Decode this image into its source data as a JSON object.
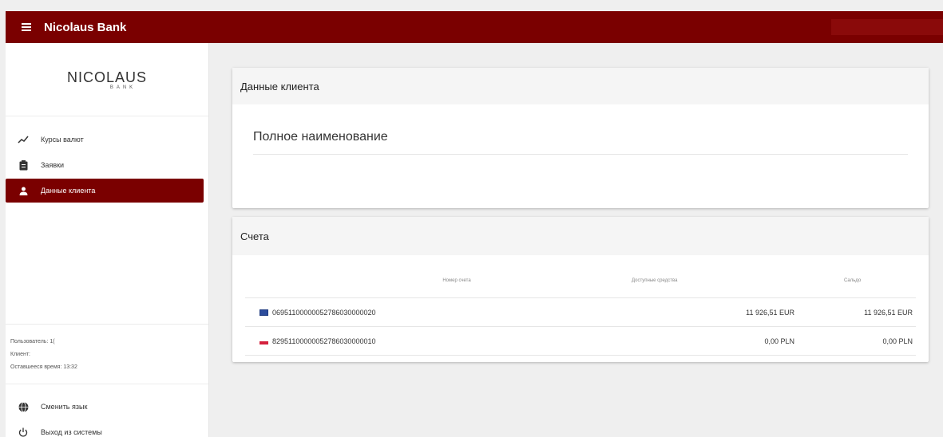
{
  "header": {
    "title": "Nicolaus Bank",
    "bg_color": "#7a0000"
  },
  "sidebar": {
    "logo_main": "NICOLAUS",
    "logo_sub": "BANK",
    "items": [
      {
        "label": "Курсы валют",
        "icon": "trending-up-icon"
      },
      {
        "label": "Заявки",
        "icon": "clipboard-icon"
      },
      {
        "label": "Данные клиента",
        "icon": "person-icon",
        "active": true
      }
    ],
    "user_info": {
      "user": "Пользователь: 1(",
      "client": "Клиент:",
      "time_left": "Оставшееся время: 13:32"
    },
    "bottom_items": [
      {
        "label": "Сменить язык",
        "icon": "globe-icon"
      },
      {
        "label": "Выход из системы",
        "icon": "power-icon"
      }
    ]
  },
  "client_card": {
    "title": "Данные клиента",
    "full_name_label": "Полное наименование"
  },
  "accounts_card": {
    "title": "Счета",
    "columns": [
      "Номер счета",
      "Доступные средства",
      "Сальдо"
    ],
    "rows": [
      {
        "flag": "eu",
        "number": "06951100000052786030000020",
        "available": "11 926,51 EUR",
        "balance": "11 926,51 EUR"
      },
      {
        "flag": "pl",
        "number": "82951100000052786030000010",
        "available": "0,00 PLN",
        "balance": "0,00 PLN"
      }
    ]
  }
}
